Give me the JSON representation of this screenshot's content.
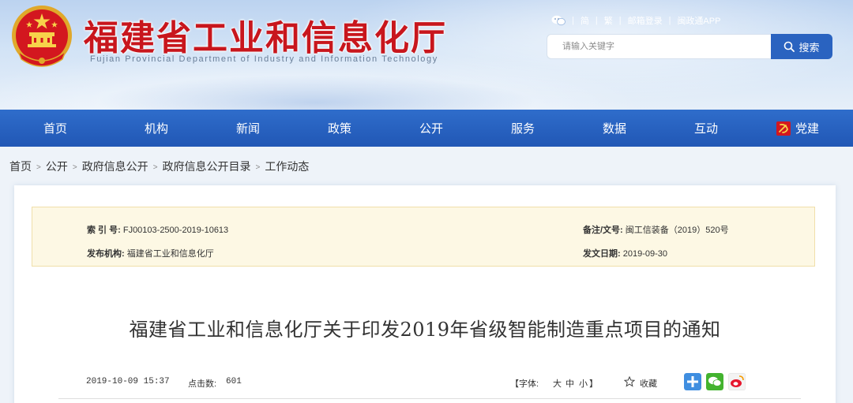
{
  "header": {
    "title": "福建省工业和信息化厅",
    "subtitle": "Fujian Provincial Department of Industry and Information Technology",
    "top_links": [
      "简",
      "繁",
      "邮箱登录",
      "闽政通APP"
    ],
    "search_placeholder": "请输入关键字",
    "search_button": "搜索",
    "colors": {
      "title": "#c8161d",
      "nav": "#2a63c0",
      "search_button": "#2a63c0"
    }
  },
  "nav": {
    "items": [
      "首页",
      "机构",
      "新闻",
      "政策",
      "公开",
      "服务",
      "数据",
      "互动",
      "党建"
    ]
  },
  "breadcrumb": [
    "首页",
    "公开",
    "政府信息公开",
    "政府信息公开目录",
    "工作动态"
  ],
  "meta": {
    "index_label": "索 引 号:",
    "index_value": "FJ00103-2500-2019-10613",
    "doc_label": "备注/文号:",
    "doc_value": "闽工信装备（2019）520号",
    "publisher_label": "发布机构:",
    "publisher_value": "福建省工业和信息化厅",
    "date_label": "发文日期:",
    "date_value": "2019-09-30"
  },
  "article": {
    "title": "福建省工业和信息化厅关于印发2019年省级智能制造重点项目的通知",
    "datetime": "2019-10-09 15:37",
    "clicks_label": "点击数:",
    "clicks": "601",
    "font_size_label": "【字体:",
    "font_sizes": [
      "大",
      "中",
      "小"
    ],
    "font_size_end": "】",
    "favorite": "收藏"
  },
  "icons": {
    "share": [
      "plus-share-icon",
      "wechat-share-icon",
      "weibo-share-icon"
    ]
  }
}
